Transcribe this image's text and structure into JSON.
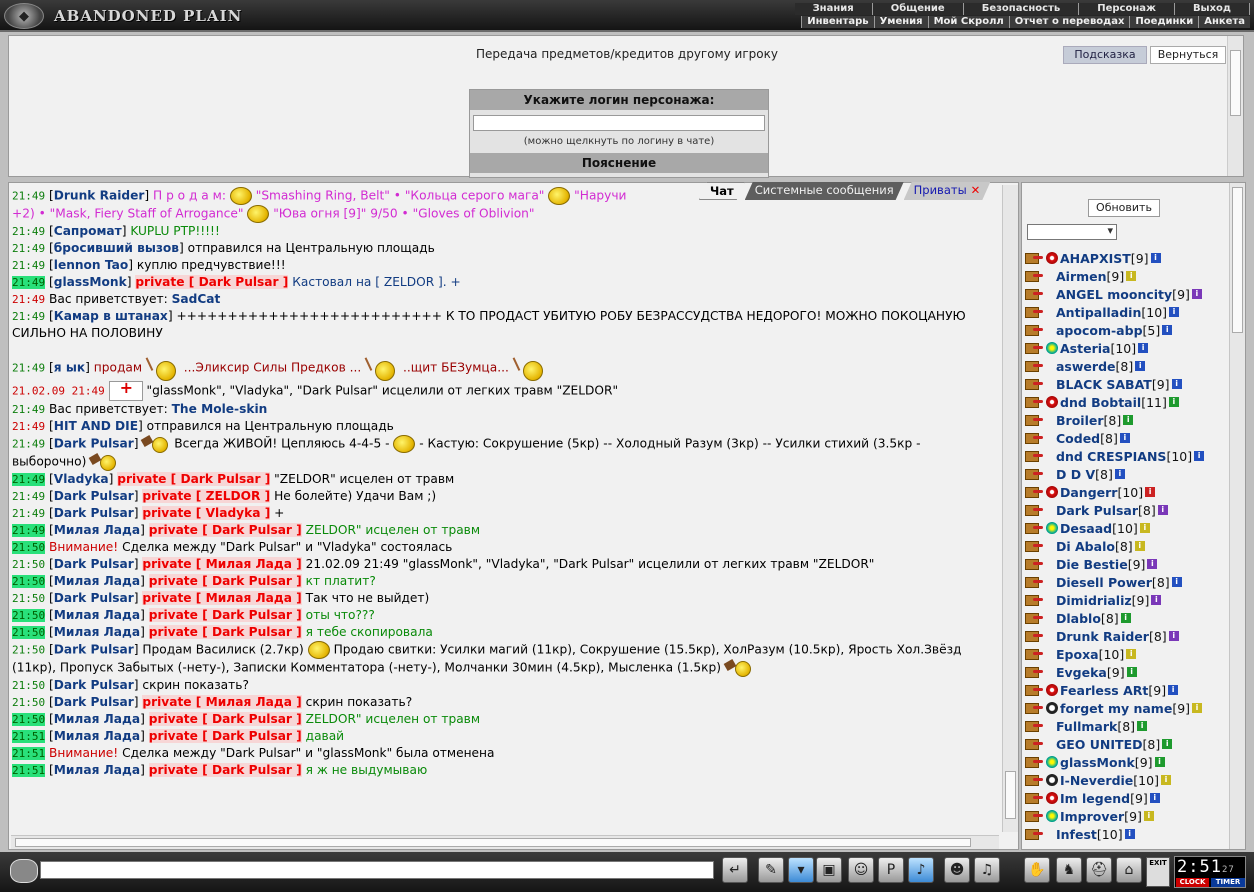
{
  "header": {
    "logo_text": "ABANDONED PLAIN",
    "menu_top": [
      "Знания",
      "Общение",
      "Безопасность",
      "Персонаж",
      "Выход"
    ],
    "menu_bottom": [
      "Инвентарь",
      "Умения",
      "Мой Скролл",
      "Отчет о переводах",
      "Поединки",
      "Анкета"
    ]
  },
  "transfer": {
    "title": "Передача предметов/кредитов другому игроку",
    "hint_button": "Подсказка",
    "back_button": "Вернуться",
    "login_heading": "Укажите логин персонажа:",
    "login_value": "",
    "login_note": "(можно щелкнуть по логину в чате)",
    "explain_heading": "Пояснение"
  },
  "tabs": {
    "chat": "Чат",
    "system": "Системные сообщения",
    "privates": "Приваты",
    "close": "✕"
  },
  "chat": [
    {
      "t": "21:49",
      "n": "Drunk Raider",
      "parts": [
        [
          "mag",
          "П р о д а м:"
        ],
        [
          "icon",
          "ring"
        ],
        [
          "mag",
          "\"Smashing Ring, Belt\" • \"Кольца серого мага\""
        ],
        [
          "icon",
          "sm"
        ],
        [
          "mag",
          "\"Наручи"
        ]
      ]
    },
    {
      "t": "",
      "parts": [
        [
          "mag",
          "+2) • \"Mask, Fiery Staff of Arrogance\""
        ],
        [
          "icon",
          "hand"
        ],
        [
          "mag",
          "\"Юва огня [9]\" 9/50 • \"Gloves of Oblivion\""
        ]
      ]
    },
    {
      "t": "21:49",
      "n": "Сапромат",
      "parts": [
        [
          "gr",
          "KUPLU PTP!!!!!"
        ]
      ]
    },
    {
      "t": "21:49",
      "n": "бросивший вызов",
      "parts": [
        [
          "",
          "отправился на Центральную площадь"
        ]
      ]
    },
    {
      "t": "21:49",
      "n": "lennon Tao",
      "parts": [
        [
          "",
          "куплю предчувствие!!!"
        ]
      ]
    },
    {
      "t": "21:49",
      "g": true,
      "n": "glassMonk",
      "p": "Dark Pulsar",
      "parts": [
        [
          "sc2",
          "Кастовал на [ ZELDOR ]. +"
        ]
      ]
    },
    {
      "t": "21:49",
      "r": true,
      "parts": [
        [
          "",
          "Вас приветствует:"
        ],
        [
          "sc",
          "SadCat"
        ]
      ]
    },
    {
      "t": "21:49",
      "n": "Камар в штанах",
      "parts": [
        [
          "",
          "++++++++++++++++++++++++++ К ТО ПРОДАСТ УБИТУЮ РОБУ БЕЗРАССУДСТВА НЕДОРОГО! МОЖНО ПОКОЦАНУЮ СИЛЬНО НА ПОЛОВИНУ"
        ]
      ],
      "wrap": true
    },
    {
      "t": "21:49",
      "n": "я ык",
      "parts": [
        [
          "brn",
          "продам"
        ],
        [
          "icon",
          "sm2"
        ],
        [
          "brn",
          "...Эликсир Силы Предков ..."
        ],
        [
          "icon",
          "sm2"
        ],
        [
          "brn",
          "..щит БЕЗумца..."
        ],
        [
          "icon",
          "sm2"
        ]
      ],
      "tall": true
    },
    {
      "t": "21.02.09 21:49",
      "r": true,
      "parts": [
        [
          "icon",
          "pill"
        ],
        [
          "",
          "\"glassMonk\", \"Vladyka\", \"Dark Pulsar\" исцелили от легких травм \"ZELDOR\""
        ]
      ]
    },
    {
      "t": "21:49",
      "parts": [
        [
          "",
          "Вас приветствует:"
        ],
        [
          "sc",
          "The Mole-skin"
        ]
      ]
    },
    {
      "t": "21:49",
      "r": true,
      "n": "HIT AND DIE",
      "parts": [
        [
          "",
          "отправился на Центральную площадь"
        ]
      ]
    },
    {
      "t": "21:49",
      "n": "Dark Pulsar",
      "parts": [
        [
          "icon",
          "hm"
        ],
        [
          "",
          "Всегда ЖИВОЙ! Цепляюсь 4-4-5 -"
        ],
        [
          "icon",
          "sm"
        ],
        [
          "",
          "- Кастую: Сокрушение (5кр) -- Холодный Разум (3кр) -- Усилки стихий (3.5кр - выборочно)"
        ],
        [
          "icon",
          "hm"
        ]
      ],
      "wrap": true
    },
    {
      "t": "21:49",
      "g": true,
      "n": "Vladyka",
      "p": "Dark Pulsar",
      "parts": [
        [
          "",
          "\"ZELDOR\" исцелен от травм"
        ]
      ]
    },
    {
      "t": "21:49",
      "n": "Dark Pulsar",
      "p": "ZELDOR",
      "parts": [
        [
          "",
          "Не болейте) Удачи Вам ;)"
        ]
      ]
    },
    {
      "t": "21:49",
      "n": "Dark Pulsar",
      "p": "Vladyka",
      "parts": [
        [
          "",
          "+"
        ]
      ]
    },
    {
      "t": "21:49",
      "g": true,
      "n": "Милая Лада",
      "p": "Dark Pulsar",
      "parts": [
        [
          "gr",
          "ZELDOR\" исцелен от травм"
        ]
      ]
    },
    {
      "t": "21:50",
      "g": true,
      "parts": [
        [
          "sys",
          "Внимание!"
        ],
        [
          "",
          "Сделка между \"Dark Pulsar\" и \"Vladyka\" состоялась"
        ]
      ]
    },
    {
      "t": "21:50",
      "n": "Dark Pulsar",
      "p": "Милая Лада",
      "parts": [
        [
          "",
          "21.02.09 21:49 \"glassMonk\", \"Vladyka\", \"Dark Pulsar\" исцелили от легких травм \"ZELDOR\""
        ]
      ]
    },
    {
      "t": "21:50",
      "g": true,
      "n": "Милая Лада",
      "p": "Dark Pulsar",
      "parts": [
        [
          "gr",
          "кт платит?"
        ]
      ]
    },
    {
      "t": "21:50",
      "n": "Dark Pulsar",
      "p": "Милая Лада",
      "parts": [
        [
          "",
          "Так что не выйдет)"
        ]
      ]
    },
    {
      "t": "21:50",
      "g": true,
      "n": "Милая Лада",
      "p": "Dark Pulsar",
      "parts": [
        [
          "gr",
          "оты что???"
        ]
      ]
    },
    {
      "t": "21:50",
      "g": true,
      "n": "Милая Лада",
      "p": "Dark Pulsar",
      "parts": [
        [
          "gr",
          "я тебе скопировала"
        ]
      ]
    },
    {
      "t": "21:50",
      "n": "Dark Pulsar",
      "parts": [
        [
          "",
          "Продам Василиск (2.7кр)"
        ],
        [
          "icon",
          "sm"
        ],
        [
          "",
          "Продаю свитки: Усилки магий (11кр), Сокрушение (15.5кр), ХолРазум (10.5кр), Ярость Хол.Звёзд (11кр), Пропуск Забытых (-нету-), Записки Комментатора (-нету-), Молчанки 30мин (4.5кр), Мысленка (1.5кр)"
        ],
        [
          "icon",
          "hm"
        ]
      ],
      "wrap": true
    },
    {
      "t": "21:50",
      "n": "Dark Pulsar",
      "parts": [
        [
          "",
          "скрин показать?"
        ]
      ]
    },
    {
      "t": "21:50",
      "n": "Dark Pulsar",
      "p": "Милая Лада",
      "parts": [
        [
          "",
          "скрин показать?"
        ]
      ]
    },
    {
      "t": "21:50",
      "g": true,
      "n": "Милая Лада",
      "p": "Dark Pulsar",
      "parts": [
        [
          "gr",
          "ZELDOR\" исцелен от травм"
        ]
      ]
    },
    {
      "t": "21:51",
      "g": true,
      "n": "Милая Лада",
      "p": "Dark Pulsar",
      "parts": [
        [
          "gr",
          "давай"
        ]
      ]
    },
    {
      "t": "21:51",
      "g": true,
      "parts": [
        [
          "sys",
          "Внимание!"
        ],
        [
          "",
          "Сделка между \"Dark Pulsar\" и \"glassMonk\" была отменена"
        ]
      ]
    },
    {
      "t": "21:51",
      "g": true,
      "n": "Милая Лада",
      "p": "Dark Pulsar",
      "parts": [
        [
          "gr",
          "я ж не выдумываю"
        ]
      ]
    }
  ],
  "sidebar": {
    "refresh": "Обновить",
    "filter_value": "",
    "players": [
      {
        "name": "AHAPXIST",
        "level": "9",
        "info": "b",
        "clan": "red"
      },
      {
        "name": "Airmen",
        "level": "9",
        "info": "y"
      },
      {
        "name": "ANGEL mooncity",
        "level": "9",
        "info": "p"
      },
      {
        "name": "Antipalladin",
        "level": "10",
        "info": "b"
      },
      {
        "name": "apocom-abp",
        "level": "5",
        "info": "b"
      },
      {
        "name": "Asteria",
        "level": "10",
        "info": "b",
        "clan": "gn"
      },
      {
        "name": "aswerde",
        "level": "8",
        "info": "b"
      },
      {
        "name": "BLACK SABAT",
        "level": "9",
        "info": "b"
      },
      {
        "name": "dnd Bobtail",
        "level": "11",
        "info": "g",
        "clan": "red"
      },
      {
        "name": "Broiler",
        "level": "8",
        "info": "g"
      },
      {
        "name": "Coded",
        "level": "8",
        "info": "b"
      },
      {
        "name": "dnd CRESPIANS",
        "level": "10",
        "info": "b"
      },
      {
        "name": "D D V",
        "level": "8",
        "info": "b"
      },
      {
        "name": "Dangerr",
        "level": "10",
        "info": "r",
        "clan": "red"
      },
      {
        "name": "Dark Pulsar",
        "level": "8",
        "info": "p"
      },
      {
        "name": "Desaad",
        "level": "10",
        "info": "y",
        "clan": "gn"
      },
      {
        "name": "Di Abalo",
        "level": "8",
        "info": "y"
      },
      {
        "name": "Die Bestie",
        "level": "9",
        "info": "p"
      },
      {
        "name": "Diesell Power",
        "level": "8",
        "info": "b"
      },
      {
        "name": "Dimidrializ",
        "level": "9",
        "info": "p"
      },
      {
        "name": "Dlablo",
        "level": "8",
        "info": "g"
      },
      {
        "name": "Drunk Raider",
        "level": "8",
        "info": "p"
      },
      {
        "name": "Epoxa",
        "level": "10",
        "info": "y"
      },
      {
        "name": "Evgeka",
        "level": "9",
        "info": "g"
      },
      {
        "name": "Fearless ARt",
        "level": "9",
        "info": "b",
        "clan": "red"
      },
      {
        "name": "forget my name",
        "level": "9",
        "info": "y",
        "clan": "bk"
      },
      {
        "name": "Fullmark",
        "level": "8",
        "info": "g"
      },
      {
        "name": "GEO UNITED",
        "level": "8",
        "info": "g"
      },
      {
        "name": "glassMonk",
        "level": "9",
        "info": "g",
        "clan": "gn"
      },
      {
        "name": "I-Neverdie",
        "level": "10",
        "info": "y",
        "clan": "bk"
      },
      {
        "name": "Im legend",
        "level": "9",
        "info": "b",
        "clan": "red"
      },
      {
        "name": "Improver",
        "level": "9",
        "info": "y",
        "clan": "gn"
      },
      {
        "name": "Infest",
        "level": "10",
        "info": "b"
      }
    ]
  },
  "bottom": {
    "exit": "EXIT",
    "clock_time": "2:51",
    "clock_sec": "27",
    "clock_label": "CLOCK",
    "timer_label": "TIMER",
    "message_value": ""
  }
}
